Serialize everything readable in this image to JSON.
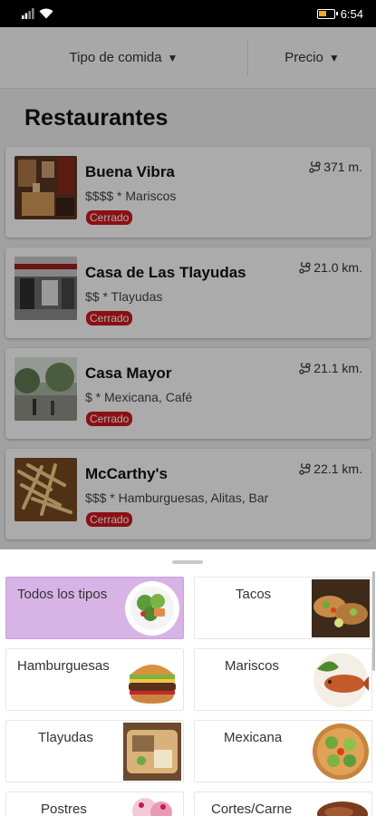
{
  "status_bar": {
    "time": "6:54",
    "battery_level": 0.55
  },
  "filters": {
    "type_label": "Tipo de comida",
    "price_label": "Precio",
    "arrow": "▼"
  },
  "section_title": "Restaurantes",
  "restaurants": [
    {
      "name": "Buena Vibra",
      "meta": "$$$$ * Mariscos",
      "status": "Cerrado",
      "distance": "371 m."
    },
    {
      "name": "Casa de Las Tlayudas",
      "meta": "$$ * Tlayudas",
      "status": "Cerrado",
      "distance": "21.0 km."
    },
    {
      "name": "Casa Mayor",
      "meta": "$ * Mexicana, Café",
      "status": "Cerrado",
      "distance": "21.1 km."
    },
    {
      "name": "McCarthy's",
      "meta": "$$$ * Hamburguesas, Alitas, Bar",
      "status": "Cerrado",
      "distance": "22.1 km."
    }
  ],
  "food_types": [
    {
      "label": "Todos los tipos",
      "selected": true
    },
    {
      "label": "Tacos",
      "selected": false
    },
    {
      "label": "Hamburguesas",
      "selected": false
    },
    {
      "label": "Mariscos",
      "selected": false
    },
    {
      "label": "Tlayudas",
      "selected": false
    },
    {
      "label": "Mexicana",
      "selected": false
    },
    {
      "label": "Postres",
      "selected": false
    },
    {
      "label": "Cortes/Carne",
      "selected": false
    }
  ],
  "colors": {
    "status_badge": "#d0191f",
    "selected_tile": "#d7b3e6"
  }
}
